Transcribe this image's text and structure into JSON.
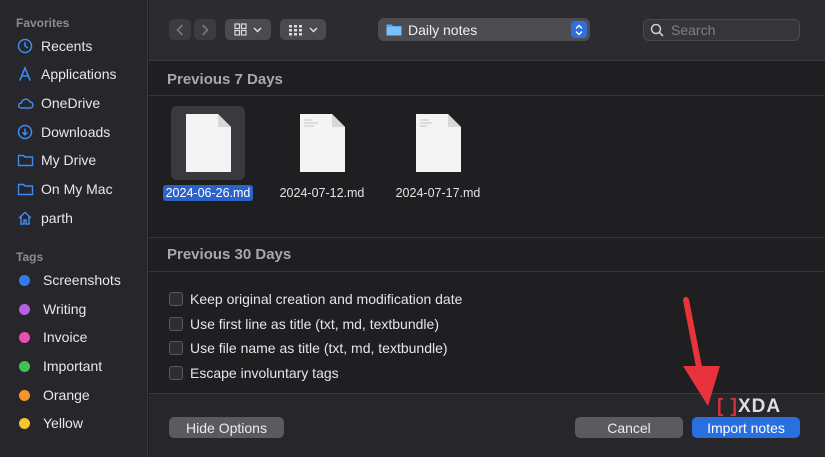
{
  "sidebar": {
    "favorites_label": "Favorites",
    "favorites": [
      {
        "label": "Recents",
        "icon": "clock-icon"
      },
      {
        "label": "Applications",
        "icon": "applications-icon"
      },
      {
        "label": "OneDrive",
        "icon": "cloud-icon"
      },
      {
        "label": "Downloads",
        "icon": "download-icon"
      },
      {
        "label": "My Drive",
        "icon": "folder-icon"
      },
      {
        "label": "On My Mac",
        "icon": "folder-icon"
      },
      {
        "label": "parth",
        "icon": "home-icon"
      }
    ],
    "tags_label": "Tags",
    "tags": [
      {
        "label": "Screenshots",
        "color": "#2f7df6"
      },
      {
        "label": "Writing",
        "color": "#b75ee3"
      },
      {
        "label": "Invoice",
        "color": "#e84fb0"
      },
      {
        "label": "Important",
        "color": "#3fc24f"
      },
      {
        "label": "Orange",
        "color": "#f5962a"
      },
      {
        "label": "Yellow",
        "color": "#f3c530"
      }
    ]
  },
  "toolbar": {
    "location": "Daily notes",
    "search_placeholder": "Search"
  },
  "groups": [
    {
      "title": "Previous 7 Days",
      "files": [
        {
          "name": "2024-06-26.md",
          "selected": true
        },
        {
          "name": "2024-07-12.md",
          "selected": false
        },
        {
          "name": "2024-07-17.md",
          "selected": false
        }
      ]
    },
    {
      "title": "Previous 30 Days"
    }
  ],
  "options": [
    {
      "label": "Keep original creation and modification date",
      "checked": false
    },
    {
      "label": "Use first line as title (txt, md, textbundle)",
      "checked": false
    },
    {
      "label": "Use file name as title (txt, md, textbundle)",
      "checked": false
    },
    {
      "label": "Escape involuntary tags",
      "checked": false
    }
  ],
  "footer": {
    "hide_options": "Hide Options",
    "cancel": "Cancel",
    "import": "Import notes"
  },
  "watermark": "XDA",
  "colors": {
    "accent": "#2a6fe0",
    "annotation_arrow": "#e8323c"
  }
}
